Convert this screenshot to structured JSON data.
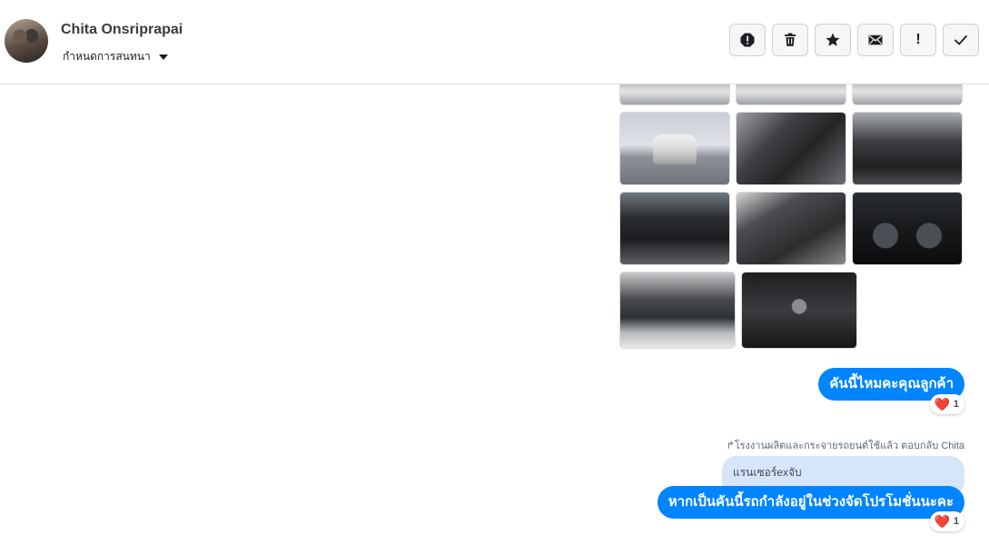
{
  "header": {
    "contact_name": "Chita Onsriprapai",
    "conversation_settings_label": "กำหนดการสนทนา",
    "toolbar": [
      {
        "name": "report-button",
        "icon": "alert-octagon-icon"
      },
      {
        "name": "delete-button",
        "icon": "trash-icon"
      },
      {
        "name": "star-button",
        "icon": "star-icon"
      },
      {
        "name": "mark-unread-button",
        "icon": "envelope-icon"
      },
      {
        "name": "important-button",
        "icon": "exclamation-icon",
        "label": "!"
      },
      {
        "name": "mark-done-button",
        "icon": "checkmark-icon"
      }
    ]
  },
  "photos": [
    {
      "name": "car-photo-top-1",
      "kind": "top-row"
    },
    {
      "name": "car-photo-top-2",
      "kind": "top-row"
    },
    {
      "name": "car-photo-top-3",
      "kind": "top-row"
    },
    {
      "name": "car-photo-rear",
      "kind": "car-rear"
    },
    {
      "name": "car-photo-front-seats",
      "kind": "seats-1"
    },
    {
      "name": "car-photo-dashboard",
      "kind": "dash-1"
    },
    {
      "name": "car-photo-console",
      "kind": "dash-2"
    },
    {
      "name": "car-photo-rear-seats",
      "kind": "seats-2"
    },
    {
      "name": "car-photo-gauges",
      "kind": "gauges"
    },
    {
      "name": "car-photo-engine",
      "kind": "engine"
    },
    {
      "name": "car-photo-shifter",
      "kind": "shifter"
    }
  ],
  "messages": {
    "first": {
      "text": "คันนี้ไหมคะคุณลูกค้า",
      "reaction_emoji": "❤️",
      "reaction_count": "1"
    },
    "reply_meta": "โรงงานผลิตและกระจายรถยนต์ใช้แล้ว ตอบกลับ Chita",
    "quoted_text": "แรนเซอร์exจับ",
    "second": {
      "text": "หากเป็นคันนี้รถกำลังอยู่ในช่วงจัดโปรโมชั่นนะคะ",
      "reaction_emoji": "❤️",
      "reaction_count": "1"
    }
  },
  "colors": {
    "bubble": "#0084ff",
    "quoted_bubble": "#d5e6fa",
    "reaction_heart": "#f33e58",
    "header_border": "#dadde1"
  }
}
